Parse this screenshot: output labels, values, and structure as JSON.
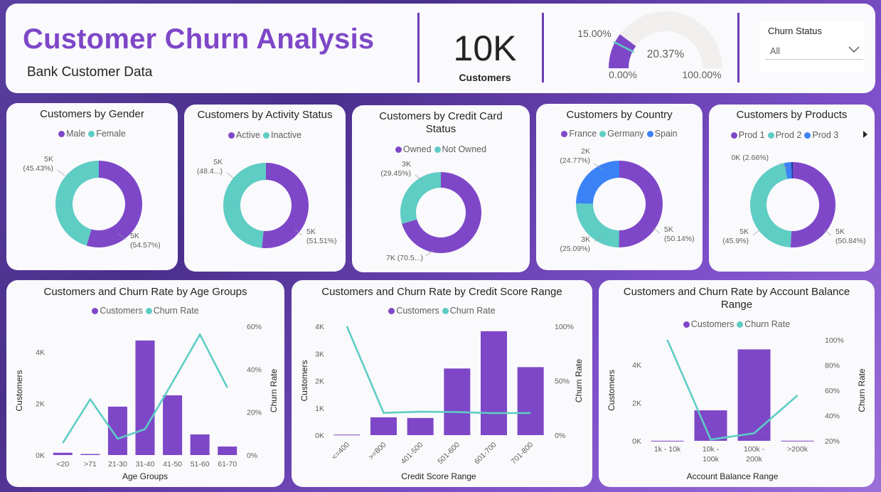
{
  "header": {
    "title": "Customer Churn Analysis",
    "subtitle": "Bank Customer Data",
    "kpi_value": "10K",
    "kpi_label": "Customers",
    "gauge": {
      "value_label": "20.37%",
      "target_label": "15.00%",
      "min_label": "0.00%",
      "max_label": "100.00%",
      "value": 20.37,
      "target": 15.0,
      "min": 0,
      "max": 100
    },
    "slicer": {
      "label": "Churn Status",
      "value": "All"
    }
  },
  "colors": {
    "primary": "#7e47c8",
    "secondary": "#5ecdc4",
    "tertiary": "#3b82f6",
    "gauge_bg": "#f0efee"
  },
  "chart_data": [
    {
      "type": "donut",
      "title": "Customers by Gender",
      "legend": [
        "Male",
        "Female"
      ],
      "values": [
        54.57,
        45.43
      ],
      "labels": [
        {
          "text": [
            "5K",
            "(54.57%)"
          ]
        },
        {
          "text": [
            "5K",
            "(45.43%)"
          ]
        }
      ]
    },
    {
      "type": "donut",
      "title": "Customers by Activity Status",
      "legend": [
        "Active",
        "Inactive"
      ],
      "values": [
        51.51,
        48.49
      ],
      "labels": [
        {
          "text": [
            "5K",
            "(51.51%)"
          ]
        },
        {
          "text": [
            "5K",
            "(48.4...)"
          ]
        }
      ]
    },
    {
      "type": "donut",
      "title": "Customers by Credit Card Status",
      "title_lines": [
        "Customers by Credit Card",
        "Status"
      ],
      "legend": [
        "Owned",
        "Not Owned"
      ],
      "values": [
        70.55,
        29.45
      ],
      "labels": [
        {
          "text": [
            "7K (70.5...)"
          ]
        },
        {
          "text": [
            "3K",
            "(29.45%)"
          ]
        }
      ]
    },
    {
      "type": "donut",
      "title": "Customers by Country",
      "legend": [
        "France",
        "Germany",
        "Spain"
      ],
      "values": [
        50.14,
        25.09,
        24.77
      ],
      "labels": [
        {
          "text": [
            "5K",
            "(50.14%)"
          ]
        },
        {
          "text": [
            "3K",
            "(25.09%)"
          ]
        },
        {
          "text": [
            "2K",
            "(24.77%)"
          ]
        }
      ]
    },
    {
      "type": "donut",
      "title": "Customers by Products",
      "legend": [
        "Prod 1",
        "Prod 2",
        "Prod 3"
      ],
      "values": [
        50.84,
        45.9,
        2.66,
        0.6
      ],
      "labels": [
        {
          "text": [
            "5K",
            "(50.84%)"
          ]
        },
        {
          "text": [
            "5K",
            "(45.9%)"
          ]
        },
        {
          "text": [
            "0K (2.66%)"
          ]
        }
      ]
    },
    {
      "type": "bar+line",
      "title": "Customers and Churn Rate by Age Groups",
      "legend": [
        "Customers",
        "Churn Rate"
      ],
      "categories": [
        "<20",
        ">71",
        "21-30",
        "31-40",
        "41-50",
        "51-60",
        "61-70"
      ],
      "bars": [
        89,
        40,
        1880,
        4450,
        2320,
        800,
        330
      ],
      "line": [
        5.6,
        26.0,
        7.6,
        12.1,
        33.9,
        56.2,
        31.4
      ],
      "y_ticks": [
        "0K",
        "2K",
        "4K"
      ],
      "y2_ticks": [
        "0%",
        "20%",
        "40%",
        "60%"
      ],
      "ylim": [
        0,
        5000
      ],
      "y2lim": [
        0,
        60
      ],
      "xlabel": "Age Groups",
      "ylabel": "Customers",
      "y2label": "Churn Rate"
    },
    {
      "type": "bar+line",
      "title": "Customers and Churn Rate by Credit Score Range",
      "legend": [
        "Customers",
        "Churn Rate"
      ],
      "categories": [
        "<=400",
        ">=800",
        "401-500",
        "501-600",
        "601-700",
        "701-800"
      ],
      "bars": [
        19,
        655,
        630,
        2450,
        3820,
        2500
      ],
      "line": [
        100,
        20.5,
        21.5,
        21.2,
        20.2,
        20.3
      ],
      "y_ticks": [
        "0K",
        "1K",
        "2K",
        "3K",
        "4K"
      ],
      "y2_ticks": [
        "0%",
        "50%",
        "100%"
      ],
      "ylim": [
        0,
        4000
      ],
      "y2lim": [
        0,
        100
      ],
      "xlabel": "Credit Score Range",
      "ylabel": "Customers",
      "y2label": "Churn Rate"
    },
    {
      "type": "bar+line",
      "title": "Customers and Churn Rate by Account Balance Range",
      "title_lines": [
        "Customers and Churn Rate by Account Balance",
        "Range"
      ],
      "legend": [
        "Customers",
        "Churn Rate"
      ],
      "categories": [
        "1k - 10k",
        "10k - 100k",
        "100k - 200k",
        ">200k"
      ],
      "category_lines": [
        [
          "1k - 10k"
        ],
        [
          "10k -",
          "100k"
        ],
        [
          "100k -",
          "200k"
        ],
        [
          ">200k"
        ]
      ],
      "bars": [
        3,
        1600,
        4800,
        5
      ],
      "line": [
        100,
        21,
        26,
        56
      ],
      "y_ticks": [
        "0K",
        "2K",
        "4K"
      ],
      "y2_ticks": [
        "20%",
        "40%",
        "60%",
        "80%",
        "100%"
      ],
      "ylim": [
        0,
        5300
      ],
      "y2lim": [
        20,
        100
      ],
      "xlabel": "Account Balance Range",
      "ylabel": "Customers",
      "y2label": "Churn Rate"
    }
  ]
}
